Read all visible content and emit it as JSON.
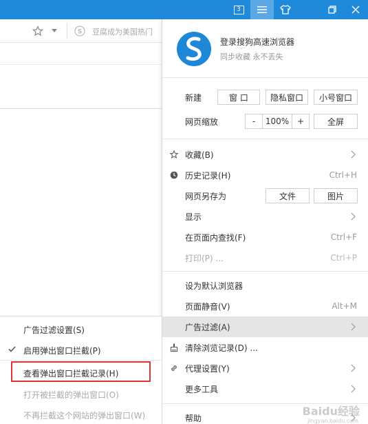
{
  "titlebar": {
    "tab_count": "3",
    "icons": [
      "tab-count-icon",
      "menu-icon",
      "skin-icon",
      "restore-icon",
      "close-icon"
    ]
  },
  "addressbar": {
    "search_placeholder": "豆腐成为美国热门"
  },
  "menu": {
    "login_title": "登录搜狗高速浏览器",
    "login_subtitle": "同步收藏 永不丢失",
    "new_label": "新建",
    "new_window": "窗 口",
    "new_private": "隐私窗口",
    "new_small": "小号窗口",
    "zoom_label": "网页缩放",
    "zoom_minus": "-",
    "zoom_value": "100%",
    "zoom_plus": "+",
    "fullscreen": "全屏",
    "favorites": "收藏(B)",
    "history": "历史记录(H)",
    "history_shortcut": "Ctrl+H",
    "save_as": "网页另存为",
    "save_file": "文件",
    "save_image": "图片",
    "display": "显示",
    "find": "在页面内查找(F)",
    "find_shortcut": "Ctrl+F",
    "print": "打印(P) ...",
    "print_shortcut": "Ctrl+P",
    "set_default": "设为默认浏览器",
    "mute": "页面静音(V)",
    "mute_shortcut": "Alt+M",
    "adfilter": "广告过滤(A)",
    "clear_history": "清除浏览记录(D) ...",
    "proxy": "代理设置(Y)",
    "more_tools": "更多工具",
    "help": "帮助"
  },
  "submenu": {
    "ad_settings": "广告过滤设置(S)",
    "enable_popup_block": "启用弹出窗口拦截(P)",
    "view_block_log": "查看弹出窗口拦截记录(H)",
    "open_blocked": "打开被拦截的弹出窗口(O)",
    "never_block": "不再拦截这个网站的弹出窗口(W)"
  },
  "watermark": {
    "main": "Baidu经验",
    "sub": "jingyan.baidu.com"
  },
  "colors": {
    "titlebar": "#1f8ad9",
    "logo": "#1e88d8",
    "highlight": "#e5e5e5",
    "annotation": "#e03333"
  }
}
